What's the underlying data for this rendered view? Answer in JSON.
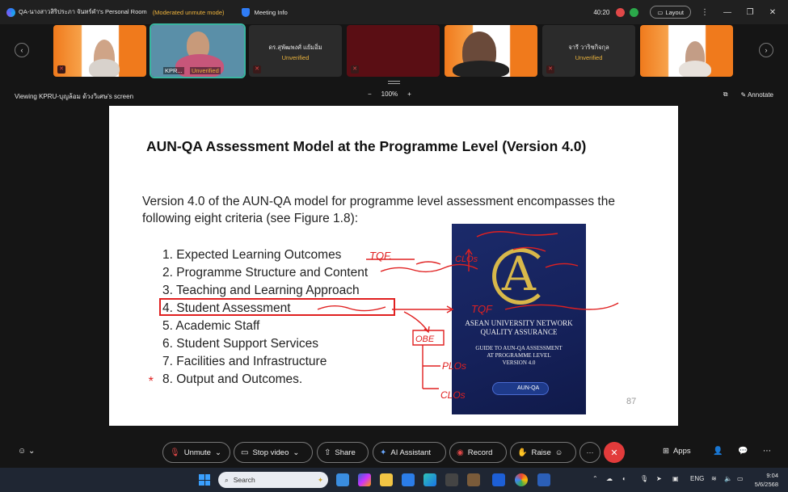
{
  "window": {
    "title": "QA-นางสาวสิริประภา จันทร์คำ's Personal Room",
    "moderated": "(Moderated unmute mode)",
    "meeting_info": "Meeting Info",
    "timer": "40:20",
    "layout_label": "Layout"
  },
  "participants": [
    {
      "name": "",
      "unverified": ""
    },
    {
      "name": "KPR...",
      "unverified": "Unverified"
    },
    {
      "name": "ดร.สุพัฒพงศ์ แย้มอิ่ม",
      "unverified": "Unverified"
    },
    {
      "name": "",
      "unverified": ""
    },
    {
      "name": "",
      "unverified": ""
    },
    {
      "name": "จารี วาริชกิจกุล",
      "unverified": "Unverified"
    },
    {
      "name": "",
      "unverified": ""
    }
  ],
  "share_bar": {
    "viewing": "Viewing KPRU-บุญล้อม ด้วงวิเศษ's screen",
    "zoom_minus": "−",
    "zoom_level": "100%",
    "zoom_plus": "+",
    "annotate": "Annotate"
  },
  "slide": {
    "title": "AUN-QA Assessment Model at the Programme Level (Version 4.0)",
    "intro": "Version 4.0 of the AUN-QA model for programme level assessment encompasses the following eight criteria (see Figure 1.8):",
    "criteria": [
      "1.  Expected Learning Outcomes",
      "2.  Programme Structure and Content",
      "3.  Teaching and Learning Approach",
      "4.  Student Assessment",
      "5.  Academic Staff",
      "6.  Student Support Services",
      "7.  Facilities and Infrastructure",
      "8.  Output and Outcomes."
    ],
    "page_number": "87",
    "book": {
      "line1": "ASEAN UNIVERSITY NETWORK",
      "line2": "QUALITY ASSURANCE",
      "line3": "GUIDE TO AUN-QA ASSESSMENT",
      "line4": "AT PROGRAMME LEVEL",
      "line5": "VERSION 4.0",
      "badge": "AUN-QA"
    },
    "annotations": {
      "tqf1": "TQF.",
      "clos1": "CLOs",
      "tqf2": "TQF",
      "obe": "OBE",
      "plos": "PLOs",
      "clos2": "CLOs",
      "star": "*"
    }
  },
  "controls": {
    "unmute": "Unmute",
    "stop_video": "Stop video",
    "share": "Share",
    "ai_assistant": "AI Assistant",
    "record": "Record",
    "raise": "Raise",
    "more": "···",
    "apps": "Apps"
  },
  "taskbar": {
    "search_placeholder": "Search",
    "lang": "ENG",
    "time": "9:04",
    "date": "5/6/2568"
  }
}
